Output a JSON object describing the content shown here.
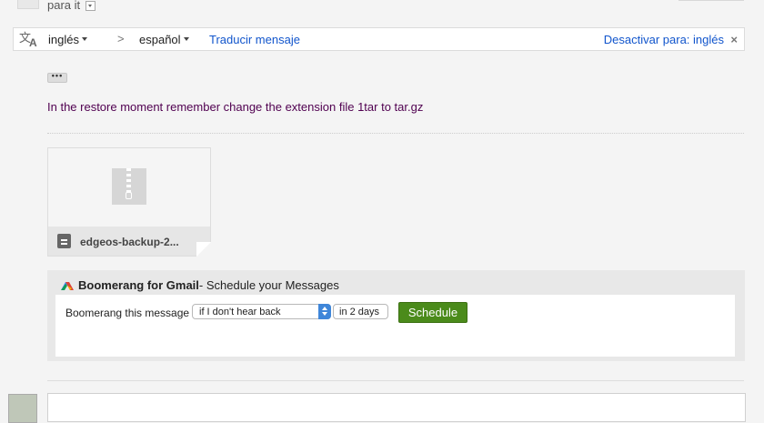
{
  "header": {
    "to_text": "para it"
  },
  "translate_bar": {
    "source_lang": "inglés",
    "arrow": ">",
    "target_lang": "español",
    "translate_label": "Traducir mensaje",
    "disable_label": "Desactivar para: inglés",
    "close_glyph": "×"
  },
  "message": {
    "ellipsis": "•••",
    "body": "In the restore moment remember change the extension file 1tar to tar.gz"
  },
  "attachment": {
    "filename": "edgeos-backup-2..."
  },
  "boomerang": {
    "brand": "Boomerang for Gmail",
    "tagline": " - Schedule your Messages",
    "label": "Boomerang this message",
    "condition": "if I don't hear back",
    "delay": "in 2 days",
    "schedule_label": "Schedule",
    "accent": "#4b8b1b"
  }
}
